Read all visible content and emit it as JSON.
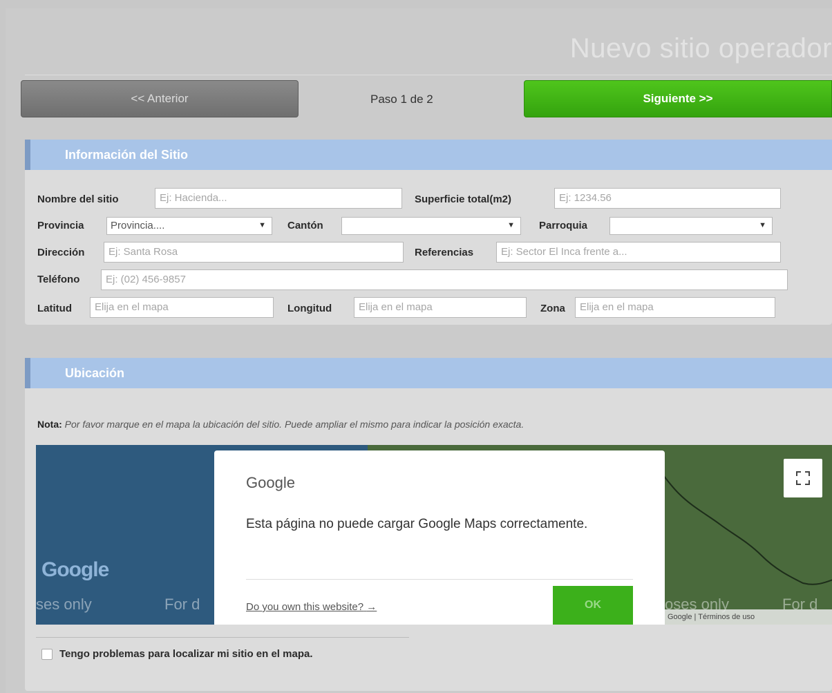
{
  "header": {
    "title": "Nuevo sitio operador",
    "prev_label": "<< Anterior",
    "step_label": "Paso 1 de 2",
    "next_label": "Siguiente >>"
  },
  "site_info": {
    "section_title": "Información del Sitio",
    "nombre": {
      "label": "Nombre del sitio",
      "placeholder": "Ej: Hacienda..."
    },
    "superficie": {
      "label": "Superficie total(m2)",
      "placeholder": "Ej: 1234.56"
    },
    "provincia": {
      "label": "Provincia",
      "value": "Provincia...."
    },
    "canton": {
      "label": "Cantón",
      "value": ""
    },
    "parroquia": {
      "label": "Parroquia",
      "value": ""
    },
    "direccion": {
      "label": "Dirección",
      "placeholder": "Ej: Santa Rosa"
    },
    "referencias": {
      "label": "Referencias",
      "placeholder": "Ej: Sector El Inca frente a..."
    },
    "telefono": {
      "label": "Teléfono",
      "placeholder": "Ej: (02) 456-9857"
    },
    "latitud": {
      "label": "Latitud",
      "placeholder": "Elija en el mapa"
    },
    "longitud": {
      "label": "Longitud",
      "placeholder": "Elija en el mapa"
    },
    "zona": {
      "label": "Zona",
      "placeholder": "Elija en el mapa"
    }
  },
  "location": {
    "section_title": "Ubicación",
    "note_label": "Nota:",
    "note_text": "Por favor marque en el mapa la ubicación del sitio. Puede ampliar el mismo para indicar la posición exacta.",
    "map": {
      "logo": "Google",
      "watermark_1": "ses only",
      "watermark_2": "For d",
      "watermark_3": "oses only",
      "watermark_4": "For d",
      "footer": "Google | Términos de uso",
      "fullscreen_icon": "fullscreen-icon",
      "dialog": {
        "brand": "Google",
        "message": "Esta página no puede cargar Google Maps correctamente.",
        "link": "Do you own this website?",
        "ok": "OK"
      }
    },
    "problem_checkbox_label": "Tengo problemas para localizar mi sitio en el mapa.",
    "problem_checked": false
  }
}
